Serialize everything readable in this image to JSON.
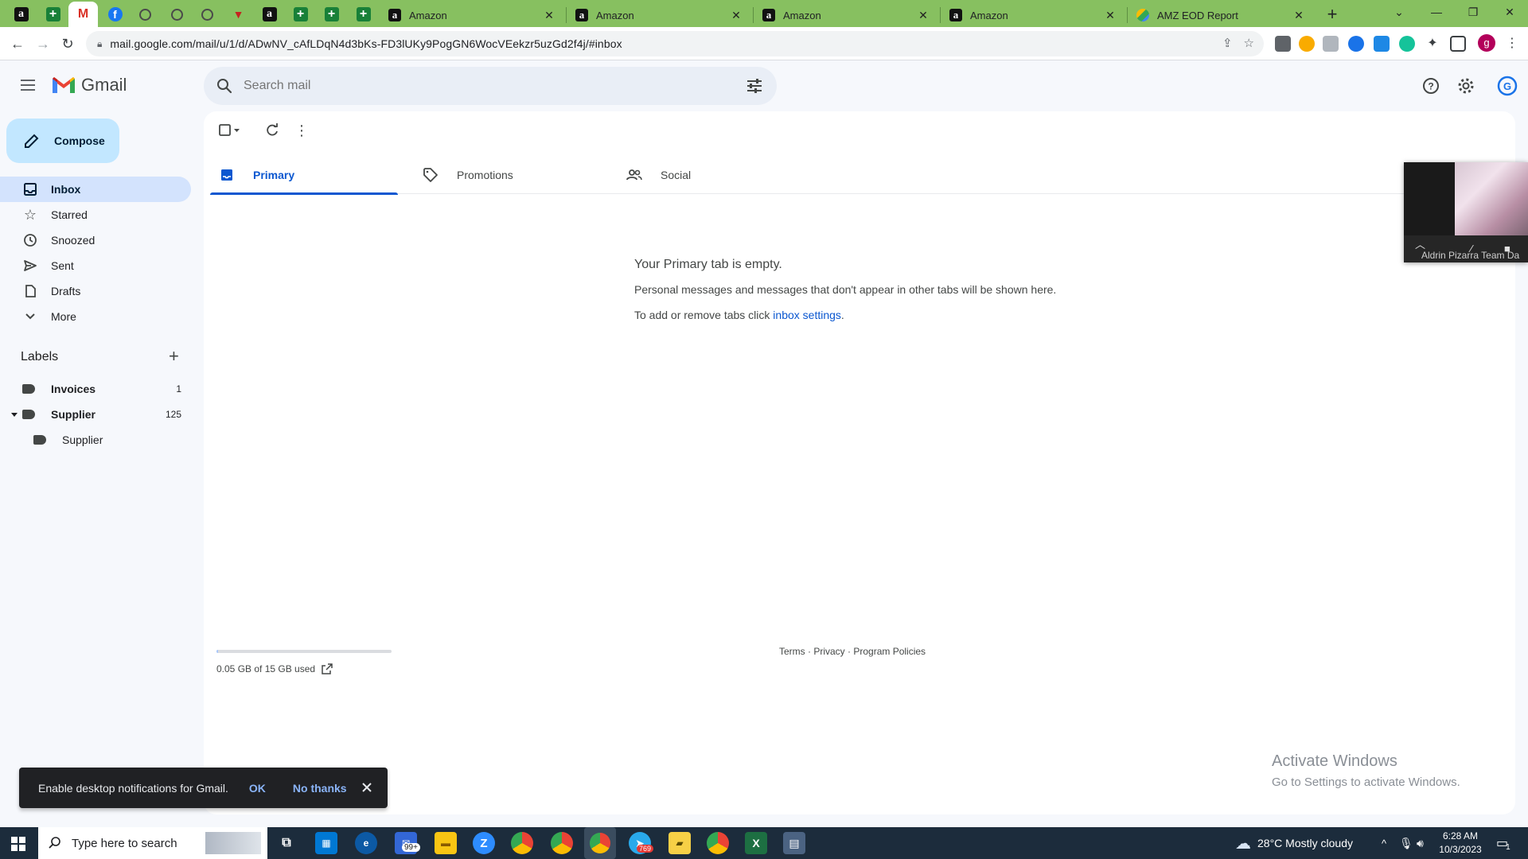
{
  "browser": {
    "tabs": [
      {
        "title": "Amazon"
      },
      {
        "title": "Amazon"
      },
      {
        "title": "Amazon"
      },
      {
        "title": "Amazon"
      },
      {
        "title": "AMZ EOD Report"
      }
    ],
    "url": "mail.google.com/mail/u/1/d/ADwNV_cAfLDqN4d3bKs-FD3lUKy9PogGN6WocVEekzr5uzGd2f4j/#inbox",
    "profile_initial": "g"
  },
  "gmail": {
    "logo_text": "Gmail",
    "search_placeholder": "Search mail",
    "compose_label": "Compose",
    "nav": [
      {
        "label": "Inbox",
        "icon": "inbox-icon"
      },
      {
        "label": "Starred",
        "icon": "star-icon"
      },
      {
        "label": "Snoozed",
        "icon": "clock-icon"
      },
      {
        "label": "Sent",
        "icon": "send-icon"
      },
      {
        "label": "Drafts",
        "icon": "draft-icon"
      },
      {
        "label": "More",
        "icon": "chevron-down-icon"
      }
    ],
    "labels_heading": "Labels",
    "labels": [
      {
        "name": "Invoices",
        "count": "1"
      },
      {
        "name": "Supplier",
        "count": "125"
      },
      {
        "name": "Supplier",
        "count": ""
      }
    ],
    "tabs": [
      {
        "label": "Primary",
        "icon": "inbox-icon"
      },
      {
        "label": "Promotions",
        "icon": "tag-icon"
      },
      {
        "label": "Social",
        "icon": "people-icon"
      }
    ],
    "empty_title": "Your Primary tab is empty.",
    "empty_desc": "Personal messages and messages that don't appear in other tabs will be shown here.",
    "empty_settings_prefix": "To add or remove tabs click ",
    "empty_settings_link": "inbox settings",
    "empty_settings_suffix": ".",
    "storage_text": "0.05 GB of 15 GB used",
    "storage_fraction": 0.003,
    "footer_terms": "Terms",
    "footer_privacy": "Privacy",
    "footer_policies": "Program Policies",
    "footer_sep": " · "
  },
  "video_tile": {
    "name": "Aldrin Pizarra Team Da"
  },
  "snackbar": {
    "message": "Enable desktop notifications for Gmail.",
    "ok": "OK",
    "no_thanks": "No thanks"
  },
  "watermark": {
    "line1": "Activate Windows",
    "line2": "Go to Settings to activate Windows."
  },
  "taskbar": {
    "search_placeholder": "Type here to search",
    "mail_badge": "99+",
    "telegram_badge": "769",
    "weather": "28°C  Mostly cloudy",
    "time": "6:28 AM",
    "date": "10/3/2023",
    "notif_count": "1"
  },
  "colors": {
    "tab_strip": "#87c060",
    "accent_blue": "#0b57d0",
    "compose_bg": "#c2e7ff",
    "inbox_active": "#d3e3fd"
  }
}
